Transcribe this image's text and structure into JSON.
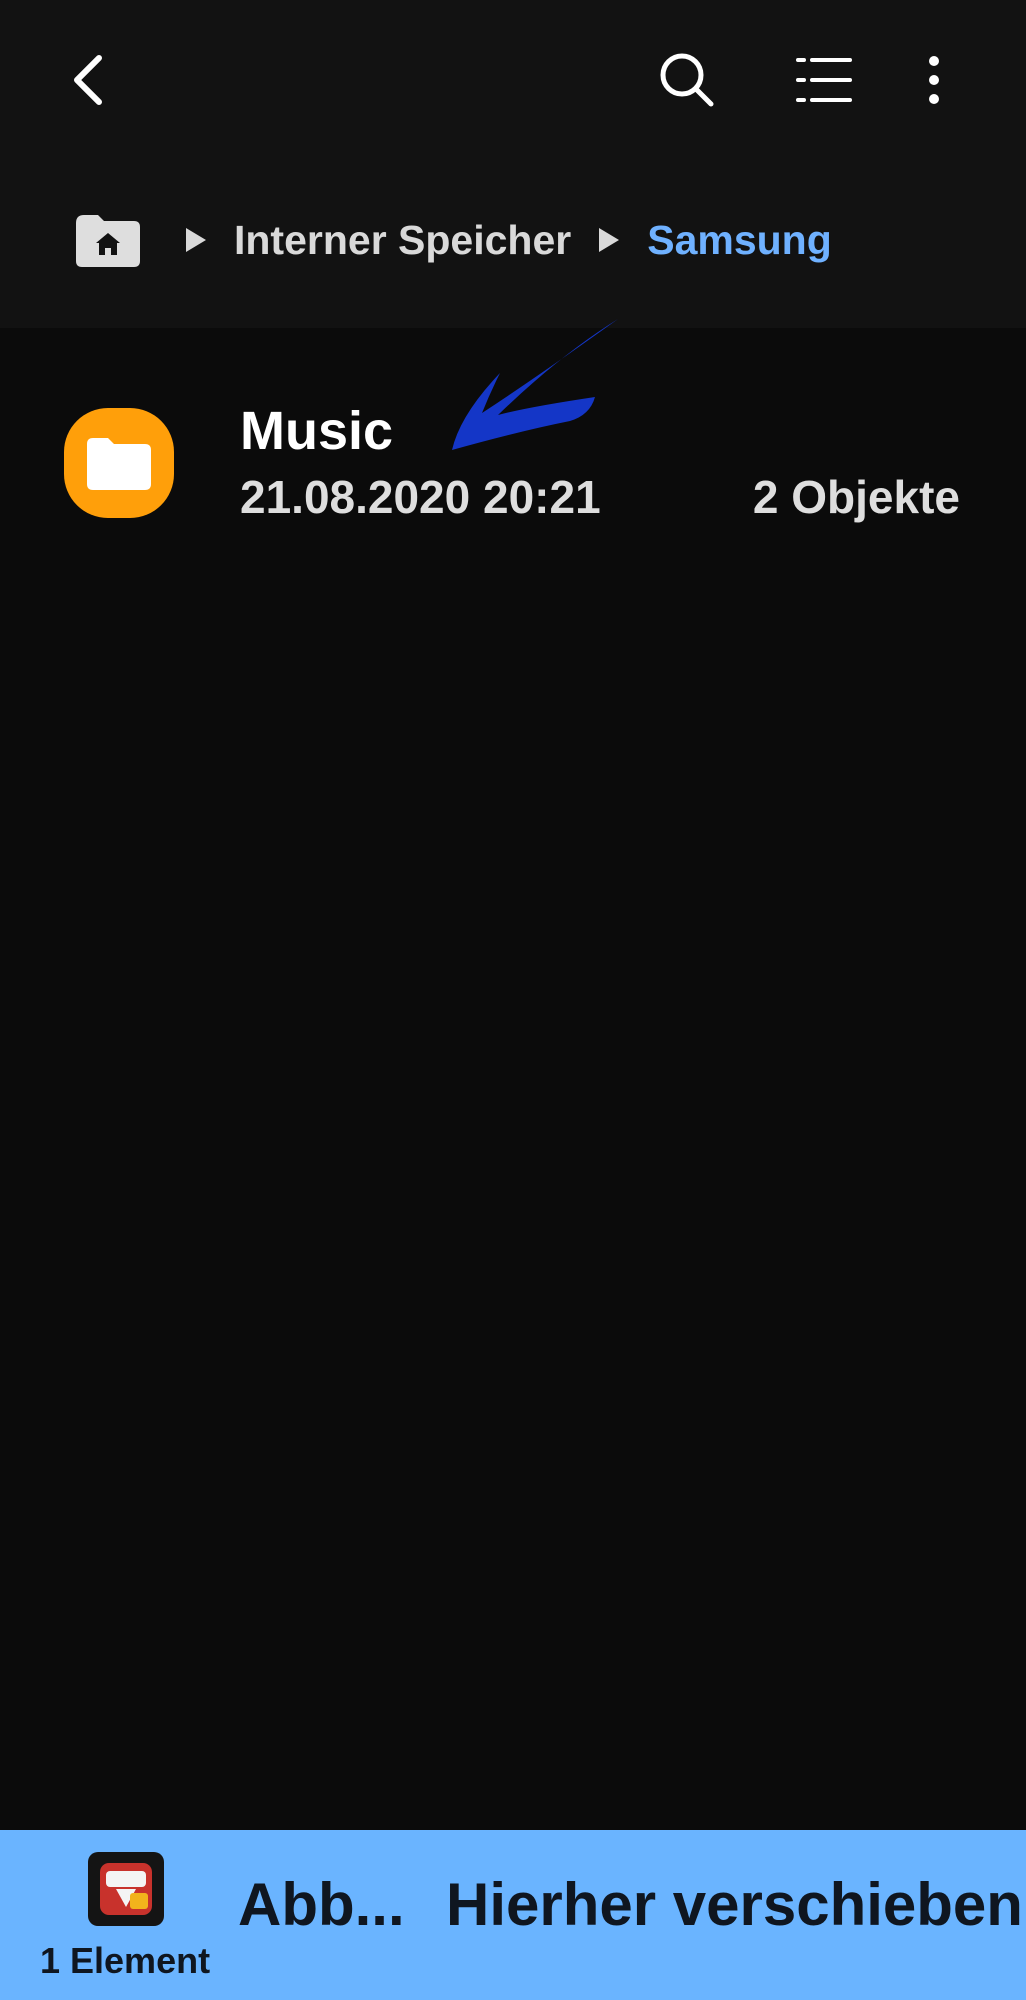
{
  "breadcrumb": {
    "items": [
      "Interner Speicher",
      "Samsung"
    ]
  },
  "files": [
    {
      "name": "Music",
      "modified": "21.08.2020 20:21",
      "count": "2 Objekte",
      "icon": "folder-icon"
    }
  ],
  "bottom_bar": {
    "selection_count": "1 Element",
    "cancel_label": "Abb...",
    "move_label": "Hierher verschieben"
  },
  "colors": {
    "top_bar_bg": "#121212",
    "list_bg": "#0b0b0b",
    "breadcrumb_active": "#6fb1ff",
    "folder_icon": "#ff9f0a",
    "bottom_bar_bg": "#6ab4ff",
    "annotation_arrow": "#1436c7"
  }
}
